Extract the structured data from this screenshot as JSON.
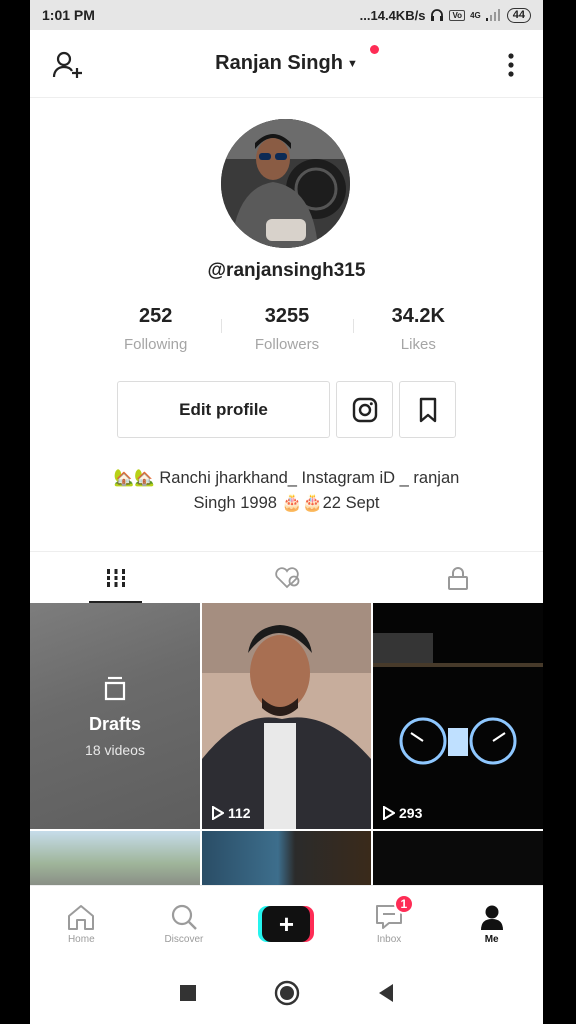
{
  "status": {
    "time": "1:01 PM",
    "speed": "...14.4KB/s",
    "net": "4G",
    "battery": "44"
  },
  "header": {
    "title": "Ranjan Singh"
  },
  "profile": {
    "username": "@ranjansingh315",
    "stats": [
      {
        "value": "252",
        "label": "Following"
      },
      {
        "value": "3255",
        "label": "Followers"
      },
      {
        "value": "34.2K",
        "label": "Likes"
      }
    ],
    "edit_label": "Edit profile",
    "bio_line1": "🏡🏡 Ranchi jharkhand_  Instagram iD _ ranjan",
    "bio_line2": "Singh 1998  🎂🎂22 Sept"
  },
  "grid": {
    "drafts_label": "Drafts",
    "drafts_count": "18 videos",
    "videos": [
      {
        "views": "112"
      },
      {
        "views": "293"
      }
    ]
  },
  "nav": {
    "home": "Home",
    "discover": "Discover",
    "inbox": "Inbox",
    "inbox_badge": "1",
    "me": "Me"
  },
  "colors": {
    "accent": "#fe2c55",
    "cyan": "#25f4ee"
  }
}
